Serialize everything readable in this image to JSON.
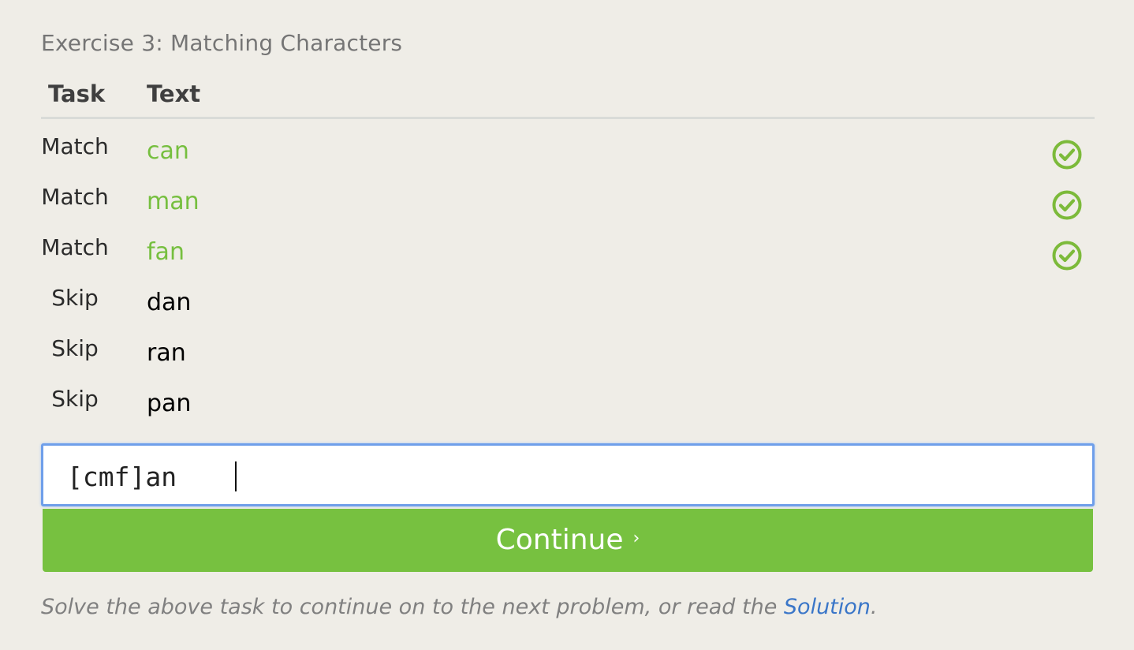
{
  "exercise": {
    "title": "Exercise 3: Matching Characters"
  },
  "table": {
    "headers": {
      "task": "Task",
      "text": "Text"
    },
    "rows": [
      {
        "task": "Match",
        "text": "can",
        "status": "matched"
      },
      {
        "task": "Match",
        "text": "man",
        "status": "matched"
      },
      {
        "task": "Match",
        "text": "fan",
        "status": "matched"
      },
      {
        "task": "Skip",
        "text": "dan",
        "status": "none"
      },
      {
        "task": "Skip",
        "text": "ran",
        "status": "none"
      },
      {
        "task": "Skip",
        "text": "pan",
        "status": "none"
      }
    ]
  },
  "input": {
    "value": "[cmf]an"
  },
  "continue_button": {
    "label": "Continue",
    "arrow": "›"
  },
  "footer": {
    "text_before": "Solve the above task to continue on to the next problem, or read the ",
    "link_text": "Solution",
    "text_after": "."
  },
  "colors": {
    "accent_green": "#77c140",
    "match_text_green": "#76bf3f",
    "check_icon_green": "#7cba3a",
    "link_blue": "#3a76c8",
    "input_focus_border": "#6f9fea",
    "background": "#efede7"
  },
  "icons": {
    "row_status": "check-circle-icon"
  }
}
